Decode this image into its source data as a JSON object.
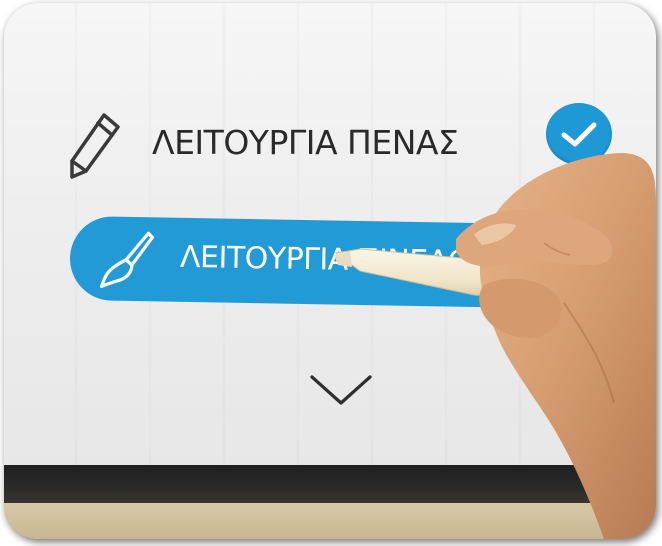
{
  "menu": {
    "pen_mode_label": "ΛΕΙΤΟΥΡΓΙΑ ΠΕΝΑΣ",
    "brush_mode_label": "ΛΕΙΤΟΥΡΓΙΑ ΠΙΝΕΛΟΥ",
    "pen_mode_selected": true
  },
  "icons": {
    "pen": "pen-icon",
    "brush": "brush-icon",
    "check": "check-icon",
    "expand": "chevron-down-icon"
  },
  "colors": {
    "accent": "#229ad6",
    "screen": "#f0f0f0",
    "text": "#2a2a2a"
  }
}
